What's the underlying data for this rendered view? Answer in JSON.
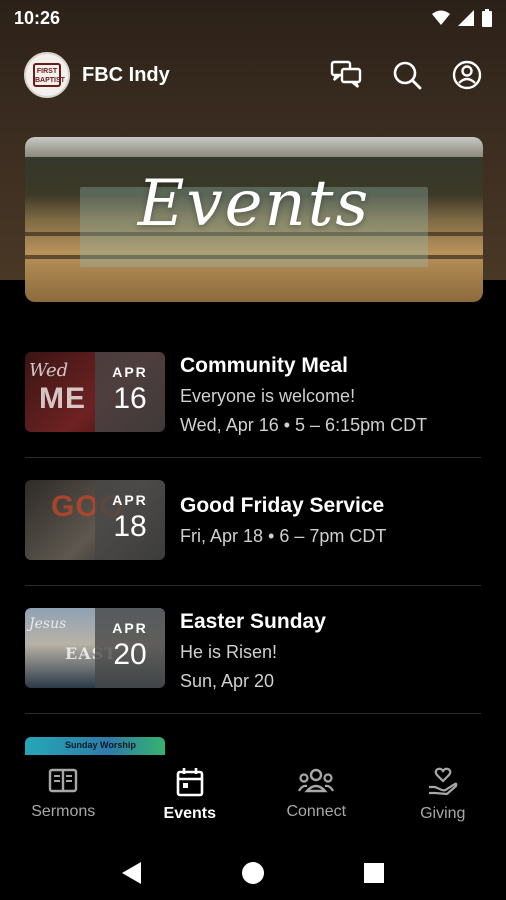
{
  "status_bar": {
    "time": "10:26"
  },
  "app_bar": {
    "title": "FBC Indy",
    "logo_text": "FIRST BAPTIST"
  },
  "banner": {
    "title": "Events"
  },
  "events": [
    {
      "title": "Community Meal",
      "subtitle": "Everyone is welcome!",
      "when": "Wed, Apr 16 • 5 – 6:15pm CDT",
      "month": "APR",
      "day": "16"
    },
    {
      "title": "Good Friday Service",
      "subtitle": "",
      "when": "Fri, Apr 18 • 6 – 7pm CDT",
      "month": "APR",
      "day": "18"
    },
    {
      "title": "Easter Sunday",
      "subtitle": "He is Risen!",
      "when": "Sun, Apr 20",
      "month": "APR",
      "day": "20"
    }
  ],
  "partial_event": {
    "thumb_text": "Sunday Worship"
  },
  "bottom_nav": [
    {
      "label": "Sermons",
      "icon": "book-icon",
      "active": false
    },
    {
      "label": "Events",
      "icon": "calendar-icon",
      "active": true
    },
    {
      "label": "Connect",
      "icon": "group-icon",
      "active": false
    },
    {
      "label": "Giving",
      "icon": "hand-heart-icon",
      "active": false
    }
  ]
}
